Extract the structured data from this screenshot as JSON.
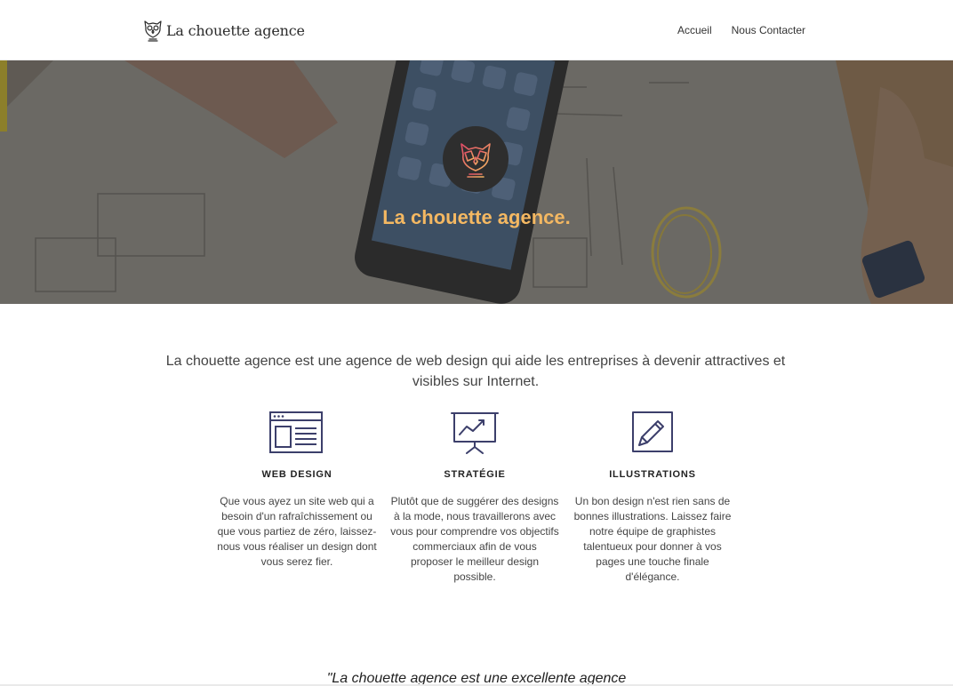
{
  "header": {
    "logo_text": "La chouette agence",
    "nav": [
      {
        "label": "Accueil"
      },
      {
        "label": "Nous Contacter"
      }
    ]
  },
  "hero": {
    "title": "La chouette agence."
  },
  "intro": {
    "text": "La chouette agence est une agence de web design qui aide les entreprises à devenir attractives et visibles sur Internet."
  },
  "services": [
    {
      "icon": "browser-window-icon",
      "title": "WEB DESIGN",
      "description": "Que vous ayez un site web qui a besoin d'un rafraîchissement ou que vous partiez de zéro, laissez-nous vous réaliser un design dont vous serez fier."
    },
    {
      "icon": "presentation-chart-icon",
      "title": "STRATÉGIE",
      "description": "Plutôt que de suggérer des designs à la mode, nous travaillerons avec vous pour comprendre vos objectifs commerciaux afin de vous proposer le meilleur design possible."
    },
    {
      "icon": "pencil-icon",
      "title": "ILLUSTRATIONS",
      "description": "Un bon design n'est rien sans de bonnes illustrations. Laissez faire notre équipe de graphistes talentueux pour donner à vos pages une touche finale d'élégance."
    }
  ],
  "quote": {
    "text": "\"La chouette agence est une excellente agence"
  },
  "colors": {
    "accent": "#f4b862",
    "icon_stroke": "#3c3f6b",
    "badge_bg": "#2e2e2e"
  }
}
